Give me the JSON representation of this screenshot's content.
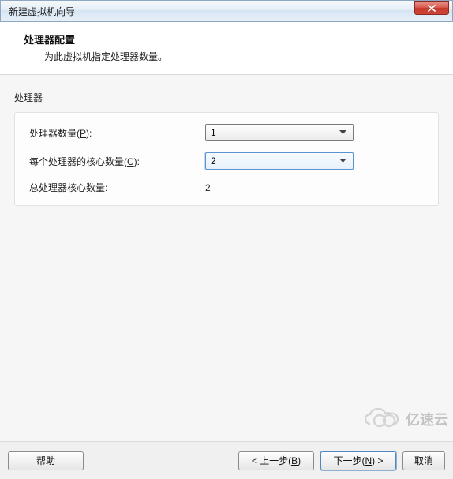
{
  "titlebar": {
    "title": "新建虚拟机向导"
  },
  "header": {
    "title": "处理器配置",
    "subtitle": "为此虚拟机指定处理器数量。"
  },
  "group": {
    "label": "处理器"
  },
  "fields": {
    "processor_count": {
      "label_pre": "处理器数量(",
      "hotkey": "P",
      "label_post": "):",
      "value": "1"
    },
    "cores_per_processor": {
      "label_pre": "每个处理器的核心数量(",
      "hotkey": "C",
      "label_post": "):",
      "value": "2"
    },
    "total_cores": {
      "label": "总处理器核心数量:",
      "value": "2"
    }
  },
  "buttons": {
    "help": "帮助",
    "back_pre": "< 上一步(",
    "back_hot": "B",
    "back_post": ")",
    "next_pre": "下一步(",
    "next_hot": "N",
    "next_post": ") >",
    "cancel": "取消"
  },
  "watermark": {
    "text": "亿速云"
  }
}
